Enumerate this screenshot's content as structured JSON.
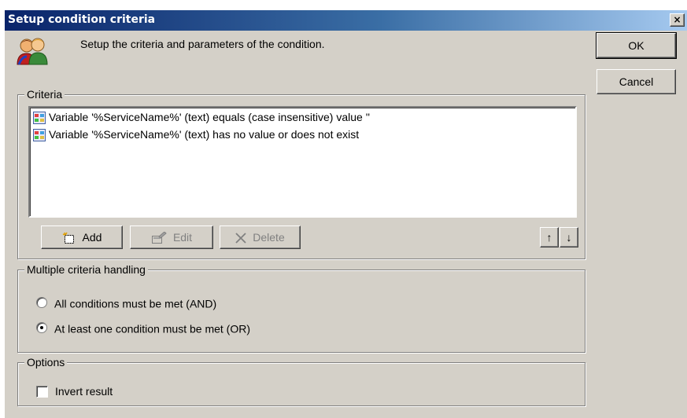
{
  "window": {
    "title": "Setup condition criteria",
    "close_label": "×",
    "accent": "#0a246a"
  },
  "header": {
    "description": "Setup the criteria and parameters of the condition.",
    "icon": "users-icon"
  },
  "dialog_buttons": {
    "ok": "OK",
    "cancel": "Cancel"
  },
  "criteria": {
    "label": "Criteria",
    "items": [
      {
        "text": "Variable '%ServiceName%' (text) equals (case insensitive) value ''",
        "icon": "criteria-item-icon"
      },
      {
        "text": "Variable '%ServiceName%' (text) has no value or does not exist",
        "icon": "criteria-item-icon"
      }
    ],
    "buttons": {
      "add": "Add",
      "edit": "Edit",
      "delete": "Delete",
      "move_up": "↑",
      "move_down": "↓"
    }
  },
  "multiple_criteria": {
    "label": "Multiple criteria handling",
    "options": [
      {
        "label": "All conditions must be met (AND)",
        "checked": false
      },
      {
        "label": "At least one condition must be met (OR)",
        "checked": true
      }
    ]
  },
  "options": {
    "label": "Options",
    "invert_result_label": "Invert result",
    "invert_result_checked": false
  }
}
